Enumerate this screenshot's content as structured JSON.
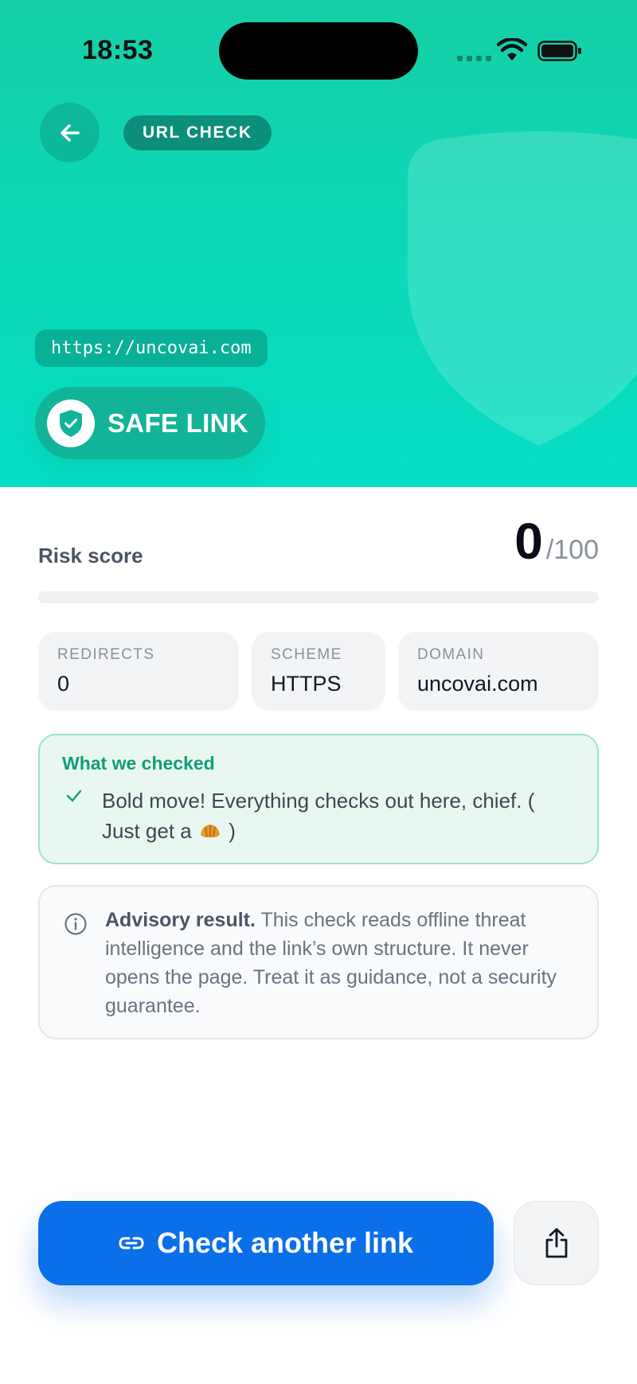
{
  "status_bar": {
    "time": "18:53"
  },
  "header": {
    "back_icon": "arrow-left-icon",
    "chip_label": "URL CHECK",
    "url": "https://uncovai.com",
    "verdict_icon": "shield-check-icon",
    "verdict_label": "SAFE LINK"
  },
  "risk": {
    "label": "Risk score",
    "score": "0",
    "max": "/100",
    "fill_fraction": 0
  },
  "stats": {
    "redirects": {
      "label": "REDIRECTS",
      "value": "0"
    },
    "scheme": {
      "label": "SCHEME",
      "value": "HTTPS"
    },
    "domain": {
      "label": "DOMAIN",
      "value": "uncovai.com"
    }
  },
  "checks": {
    "title": "What we checked",
    "item_text": "Bold move! Everything checks out here, chief.  ( Just get a",
    "item_emoji": "croissant-icon",
    "item_suffix": ")"
  },
  "advisory": {
    "strong": "Advisory result.",
    "text": " This check reads offline threat intelligence and the link’s own structure. It never opens the page. Treat it as guidance, not a security guarantee."
  },
  "actions": {
    "primary_label": "Check another link",
    "primary_icon": "link-icon",
    "share_icon": "share-icon"
  },
  "colors": {
    "hero_teal": "#0dd8b6",
    "badge_green": "#12b497",
    "primary_blue": "#0a6fe8",
    "check_green": "#139c78"
  }
}
